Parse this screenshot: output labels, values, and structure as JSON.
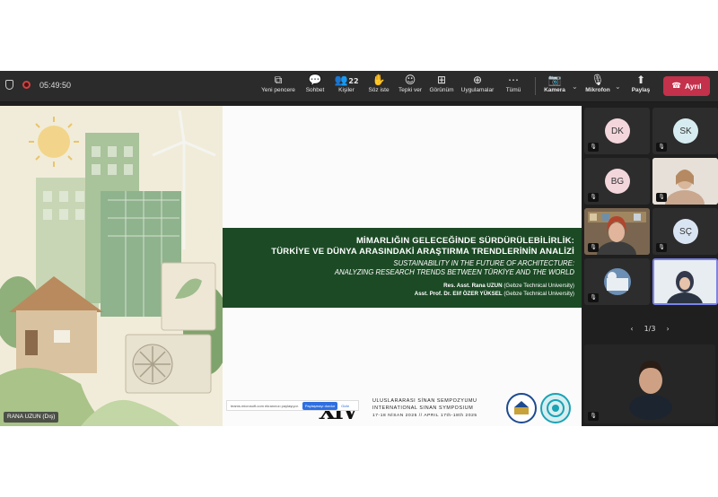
{
  "toolbar": {
    "time": "05:49:50",
    "buttons": [
      {
        "label": "Yeni pencere",
        "icon": "new-window-icon"
      },
      {
        "label": "Sohbet",
        "icon": "chat-icon"
      },
      {
        "label": "Kişiler",
        "icon": "people-icon",
        "count": "22"
      },
      {
        "label": "Söz iste",
        "icon": "raise-hand-icon"
      },
      {
        "label": "Tepki ver",
        "icon": "react-icon"
      },
      {
        "label": "Görünüm",
        "icon": "view-icon"
      },
      {
        "label": "Uygulamalar",
        "icon": "apps-icon"
      },
      {
        "label": "Tümü",
        "icon": "more-icon"
      },
      {
        "label": "Kamera",
        "icon": "camera-off-icon"
      },
      {
        "label": "Mikrofon",
        "icon": "mic-off-icon"
      },
      {
        "label": "Paylaş",
        "icon": "share-icon"
      }
    ],
    "leave_label": "Ayrıl",
    "leave_color": "#c4314b"
  },
  "slide": {
    "title_tr_1": "MİMARLIĞIN GELECEĞİNDE SÜRDÜRÜLEBİLİRLİK:",
    "title_tr_2": "TÜRKİYE VE DÜNYA ARASINDAKİ ARAŞTIRMA TRENDLERİNİN ANALİZİ",
    "title_en_1": "SUSTAINABILITY IN THE FUTURE OF ARCHITECTURE:",
    "title_en_2": "ANALYZING RESEARCH TRENDS BETWEEN TÜRKİYE AND THE WORLD",
    "author1_name": "Res. Asst. Rana UZUN",
    "author1_aff": "(Gebze Technical University)",
    "author2_name": "Asst. Prof. Dr. Elif ÖZER YÜKSEL",
    "author2_aff": "(Gebze Technical University)",
    "band_color": "#1c4a25",
    "symposium_mark": "XIV",
    "symposium_line1": "ULUSLARARASI SİNAN SEMPOZYUMU",
    "symposium_line2": "INTERNATIONAL SINAN SYMPOSIUM",
    "symposium_line3": "17-18 NİSAN 2025 // APRIL 17th-18th 2025"
  },
  "share_notice": {
    "text": "teams.microsoft.com ekranınızı paylaşıyor.",
    "button": "Paylaşmayı durdur",
    "hide": "Gizle"
  },
  "presenter_label": "RANA UZUN (Dış)",
  "participants": [
    {
      "initials": "DK",
      "color": "#f3d6dc",
      "muted": true
    },
    {
      "initials": "SK",
      "color": "#d6ecf0",
      "muted": true
    },
    {
      "initials": "BG",
      "color": "#f3d6dc",
      "muted": true
    },
    {
      "initials": "",
      "video": true,
      "muted": true
    },
    {
      "initials": "",
      "video": true,
      "muted": true
    },
    {
      "initials": "SÇ",
      "color": "#d9e4f3",
      "muted": true
    },
    {
      "initials": "",
      "avatar": true,
      "muted": true
    },
    {
      "initials": "",
      "video": true,
      "muted": false
    }
  ],
  "pager": {
    "text": "1/3"
  },
  "bottom_tile": {
    "muted": true
  }
}
